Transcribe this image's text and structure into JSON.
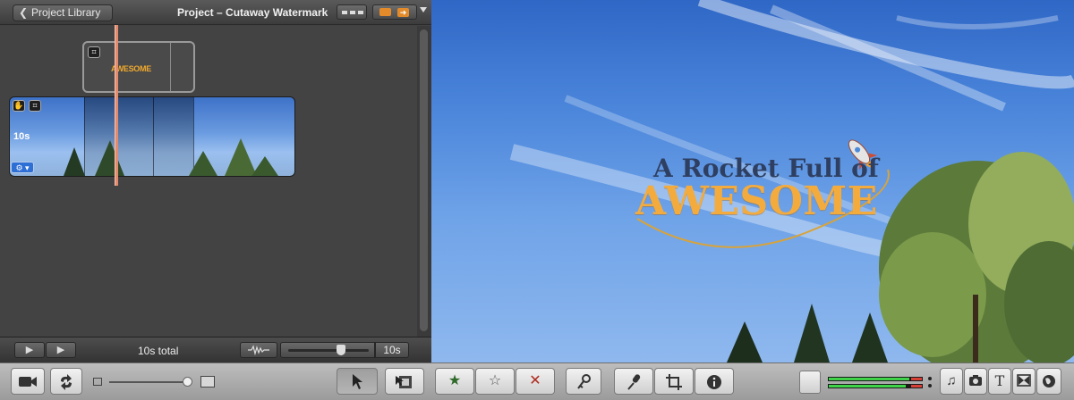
{
  "header": {
    "back_label": "Project Library",
    "project_title": "Project – Cutaway Watermark"
  },
  "timeline": {
    "clip_duration": "10s",
    "cutaway_logo_text": "AWESOME",
    "crop_badge": "⌗",
    "total_label": "10s total",
    "zoom_value": "10s"
  },
  "viewer": {
    "title_line1": "A Rocket Full of",
    "title_line2": "AWESOME"
  },
  "toolbar": {
    "title_icon": "T"
  },
  "colors": {
    "accent_orange": "#e38a2a",
    "playhead": "#e48b6e",
    "title_gold": "#f4ab3d",
    "title_navy": "#2e3f61"
  },
  "icons": [
    "chevron-left-icon",
    "view-toggle-icon",
    "share-icon",
    "camera-icon",
    "swap-icon",
    "arrow-pointer-icon",
    "add-to-project-icon",
    "favorite-star-icon",
    "unmark-star-icon",
    "reject-x-icon",
    "keyword-key-icon",
    "microphone-icon",
    "crop-icon",
    "info-icon",
    "music-note-icon",
    "photo-camera-icon",
    "title-text-icon",
    "transition-icon",
    "map-globe-icon",
    "waveform-icon"
  ]
}
